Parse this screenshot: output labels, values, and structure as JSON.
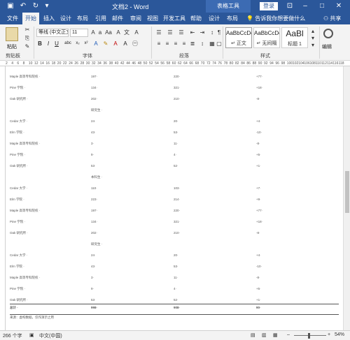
{
  "titlebar": {
    "title": "文档2 - Word",
    "context_tools": "表格工具",
    "login": "登录"
  },
  "tabs": [
    "文件",
    "开始",
    "插入",
    "设计",
    "布局",
    "引用",
    "邮件",
    "审阅",
    "视图",
    "开发工具",
    "帮助",
    "设计",
    "布局"
  ],
  "tell_me": "告诉我你想要做什么",
  "share": "共享",
  "ribbon": {
    "paste": "粘贴",
    "font_name": "等线 (中文正文",
    "font_size": "11",
    "groups": {
      "clipboard": "剪贴板",
      "font": "字体",
      "paragraph": "段落",
      "styles": "样式"
    },
    "styles": [
      {
        "preview": "AaBbCcDc",
        "name": "↵ 正文"
      },
      {
        "preview": "AaBbCcDc",
        "name": "↵ 无间隔"
      },
      {
        "preview": "AaBl",
        "name": "标题 1"
      }
    ],
    "editing": "编辑"
  },
  "ruler_ticks": [
    "2",
    "4",
    "6",
    "8",
    "10",
    "12",
    "14",
    "16",
    "18",
    "20",
    "22",
    "24",
    "26",
    "28",
    "30",
    "32",
    "34",
    "36",
    "38",
    "40",
    "42",
    "44",
    "46",
    "48",
    "50",
    "52",
    "54",
    "56",
    "58",
    "60",
    "62",
    "64",
    "66",
    "68",
    "70",
    "72",
    "74",
    "76",
    "78",
    "80",
    "82",
    "84",
    "86",
    "88",
    "90",
    "92",
    "94",
    "96",
    "98",
    "100",
    "102",
    "104",
    "106",
    "108",
    "110",
    "112",
    "114",
    "116",
    "118"
  ],
  "table_rows": [
    {
      "c1": "Maple 高等专科院校 ·",
      "c2": "197·",
      "c3": "220·",
      "c4": "+77·"
    },
    {
      "c1": "Pine 学院 ·",
      "c2": "134·",
      "c3": "321·",
      "c4": "+18·"
    },
    {
      "c1": "Oak 研究所 ·",
      "c2": "202·",
      "c3": "210·",
      "c4": "-8·"
    },
    {
      "c1": "",
      "c2": "研究生 ·",
      "c3": "",
      "c4": ""
    },
    {
      "c1": "Cedar 大学 ·",
      "c2": "24·",
      "c3": "20·",
      "c4": "+4·"
    },
    {
      "c1": "Elm 学院 ·",
      "c2": "43·",
      "c3": "53·",
      "c4": "-10·"
    },
    {
      "c1": "Maple 高等专科院校 ·",
      "c2": "3·",
      "c3": "11·",
      "c4": "-8·"
    },
    {
      "c1": "Pine 学院 ·",
      "c2": "9·",
      "c3": "4·",
      "c4": "+5·"
    },
    {
      "c1": "Oak 研究所 ·",
      "c2": "53·",
      "c3": "52·",
      "c4": "+1·"
    },
    {
      "c1": "",
      "c2": "本科生 ·",
      "c3": "",
      "c4": ""
    },
    {
      "c1": "Cedar 大学 ·",
      "c2": "110·",
      "c3": "103·",
      "c4": "+7·"
    },
    {
      "c1": "Elm 学院 ·",
      "c2": "223·",
      "c3": "214·",
      "c4": "+9·"
    },
    {
      "c1": "Maple 高等专科院校 ·",
      "c2": "197·",
      "c3": "220·",
      "c4": "+77·"
    },
    {
      "c1": "Pine 学院 ·",
      "c2": "134·",
      "c3": "321·",
      "c4": "+18·"
    },
    {
      "c1": "Oak 研究所 ·",
      "c2": "202·",
      "c3": "210·",
      "c4": "-8·"
    },
    {
      "c1": "",
      "c2": "研究生 ·",
      "c3": "",
      "c4": ""
    },
    {
      "c1": "Cedar 大学 ·",
      "c2": "24·",
      "c3": "20·",
      "c4": "+4·"
    },
    {
      "c1": "Elm 学院 ·",
      "c2": "43·",
      "c3": "53·",
      "c4": "-10·"
    },
    {
      "c1": "Maple 高等专科院校 ·",
      "c2": "3·",
      "c3": "11·",
      "c4": "-8·"
    },
    {
      "c1": "Pine 学院 ·",
      "c2": "9·",
      "c3": "4·",
      "c4": "+5·"
    },
    {
      "c1": "Oak 研究所 ·",
      "c2": "53·",
      "c3": "52·",
      "c4": "+1·"
    }
  ],
  "total_row": {
    "c1": "总计 ·",
    "c2": "998·",
    "c3": "908·",
    "c4": "90·"
  },
  "footnote": "来源：虚构数据，仅作演示之用",
  "status": {
    "words": "266 个字",
    "language": "中文(中国)",
    "zoom": "54%",
    "zoom_level_percent": 54
  }
}
